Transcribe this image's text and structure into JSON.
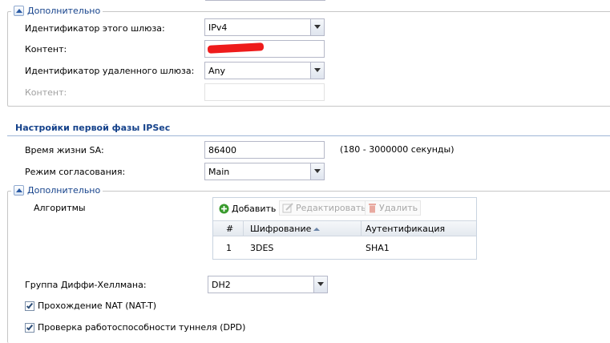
{
  "top_section": {
    "legend": "Дополнительно",
    "gateway_id_label": "Идентификатор этого шлюза:",
    "gateway_id_value": "IPv4",
    "content_label": "Контент:",
    "content_value": "",
    "remote_id_label": "Идентификатор удаленного шлюза:",
    "remote_id_value": "Any",
    "remote_content_label": "Контент:",
    "remote_content_value": ""
  },
  "phase1": {
    "title": "Настройки первой фазы IPSec",
    "sa_lifetime_label": "Время жизни SA:",
    "sa_lifetime_value": "86400",
    "sa_lifetime_hint": "(180 - 3000000 секунды)",
    "negotiation_label": "Режим согласования:",
    "negotiation_value": "Main"
  },
  "advanced": {
    "legend": "Дополнительно",
    "algorithms_label": "Алгоритмы",
    "toolbar": {
      "add": "Добавить",
      "edit": "Редактировать",
      "delete": "Удалить"
    },
    "columns": [
      "#",
      "Шифрование",
      "Аутентификация"
    ],
    "rows": [
      {
        "num": "1",
        "encryption": "3DES",
        "auth": "SHA1"
      }
    ],
    "dh_label": "Группа Диффи-Хеллмана:",
    "dh_value": "DH2",
    "nat_t_label": "Прохождение NAT (NAT-T)",
    "nat_t_checked": true,
    "dpd_label": "Проверка работоспособности туннеля (DPD)",
    "dpd_checked": true
  },
  "colors": {
    "accent": "#15428b",
    "redaction": "#ee1b1b",
    "add_icon": "#3a9b2e",
    "delete_icon": "#c23a2a"
  }
}
